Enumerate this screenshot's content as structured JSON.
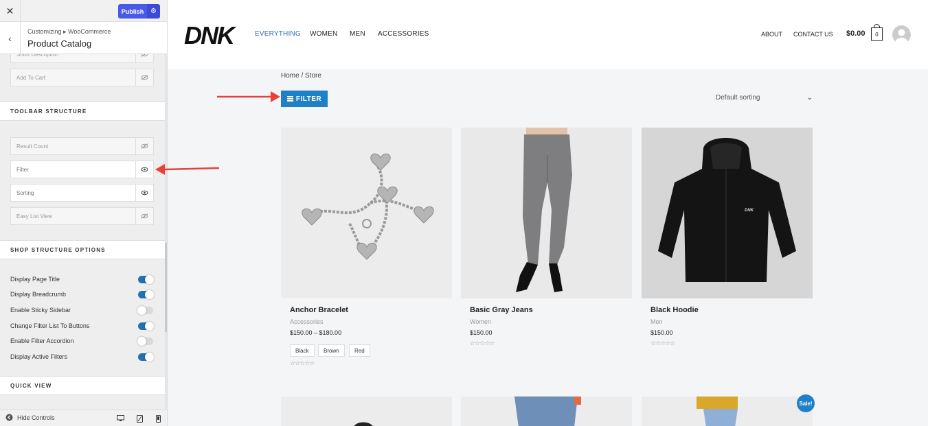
{
  "customizer": {
    "publish_label": "Publish",
    "breadcrumb": "Customizing ▸ WooCommerce",
    "panel_title": "Product Catalog",
    "top_items": [
      {
        "label": "Short Description",
        "visible": false
      },
      {
        "label": "Add To Cart",
        "visible": false
      }
    ],
    "toolbar_heading": "TOOLBAR STRUCTURE",
    "toolbar_items": [
      {
        "label": "Result Count",
        "visible": false
      },
      {
        "label": "Filter",
        "visible": true
      },
      {
        "label": "Sorting",
        "visible": true
      },
      {
        "label": "Easy List View",
        "visible": false
      }
    ],
    "shop_heading": "SHOP STRUCTURE OPTIONS",
    "shop_options": [
      {
        "label": "Display Page Title",
        "on": true
      },
      {
        "label": "Display Breadcrumb",
        "on": true
      },
      {
        "label": "Enable Sticky Sidebar",
        "on": false
      },
      {
        "label": "Change Filter List To Buttons",
        "on": true
      },
      {
        "label": "Enable Filter Accordion",
        "on": false
      },
      {
        "label": "Display Active Filters",
        "on": true
      }
    ],
    "quick_view_heading": "QUICK VIEW",
    "hide_controls_label": "Hide Controls"
  },
  "site": {
    "nav": [
      "EVERYTHING",
      "WOMEN",
      "MEN",
      "ACCESSORIES"
    ],
    "nav_right": [
      "ABOUT",
      "CONTACT US"
    ],
    "cart_total": "$0.00",
    "cart_count": "0",
    "breadcrumb": "Home / Store",
    "filter_label": "FILTER",
    "sorting_label": "Default sorting",
    "sale_badge": "Sale!",
    "products": [
      {
        "name": "Anchor Bracelet",
        "category": "Accessories",
        "price": "$150.00 – $180.00",
        "swatches": [
          "Black",
          "Brown",
          "Red"
        ],
        "rating": "☆☆☆☆☆"
      },
      {
        "name": "Basic Gray Jeans",
        "category": "Women",
        "price": "$150.00",
        "rating": "☆☆☆☆☆"
      },
      {
        "name": "Black Hoodie",
        "category": "Men",
        "price": "$150.00",
        "rating": "☆☆☆☆☆"
      }
    ]
  },
  "colors": {
    "accent": "#1f80c8",
    "publish": "#4a5ae8",
    "toggle_on": "#2271b1",
    "annotation_arrow": "#e8413c"
  }
}
